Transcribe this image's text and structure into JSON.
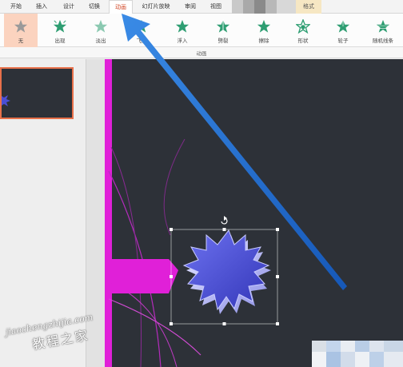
{
  "tabs": [
    {
      "label": "开始"
    },
    {
      "label": "插入"
    },
    {
      "label": "设计"
    },
    {
      "label": "切换"
    },
    {
      "label": "动画",
      "active": true
    },
    {
      "label": "幻灯片放映"
    },
    {
      "label": "审阅"
    },
    {
      "label": "视图"
    }
  ],
  "format_tab": {
    "label": "格式"
  },
  "animations": [
    {
      "label": "无",
      "selected": true,
      "icon": "star-gray-icon"
    },
    {
      "label": "出现",
      "icon": "star-burst-icon"
    },
    {
      "label": "淡出",
      "icon": "star-fade-icon"
    },
    {
      "label": "飞入",
      "icon": "star-fly-icon"
    },
    {
      "label": "浮入",
      "icon": "star-float-icon"
    },
    {
      "label": "劈裂",
      "icon": "star-split-icon"
    },
    {
      "label": "擦除",
      "icon": "star-wipe-icon"
    },
    {
      "label": "形状",
      "icon": "star-shape-icon"
    },
    {
      "label": "轮子",
      "icon": "star-wheel-icon"
    },
    {
      "label": "随机线条",
      "icon": "star-random-icon"
    }
  ],
  "ribbon_group": {
    "label": "动画"
  },
  "watermark": {
    "url": "jiaochengzhijia.com",
    "name": "教程之家"
  },
  "colors": {
    "accent_tab": "#d24726",
    "slide_bg": "#2d3138",
    "magenta_bar": "#e020d8",
    "star_fill": "#4b4fd6",
    "arrow": "#1f76d6",
    "star_icon": "#2e9e72"
  }
}
